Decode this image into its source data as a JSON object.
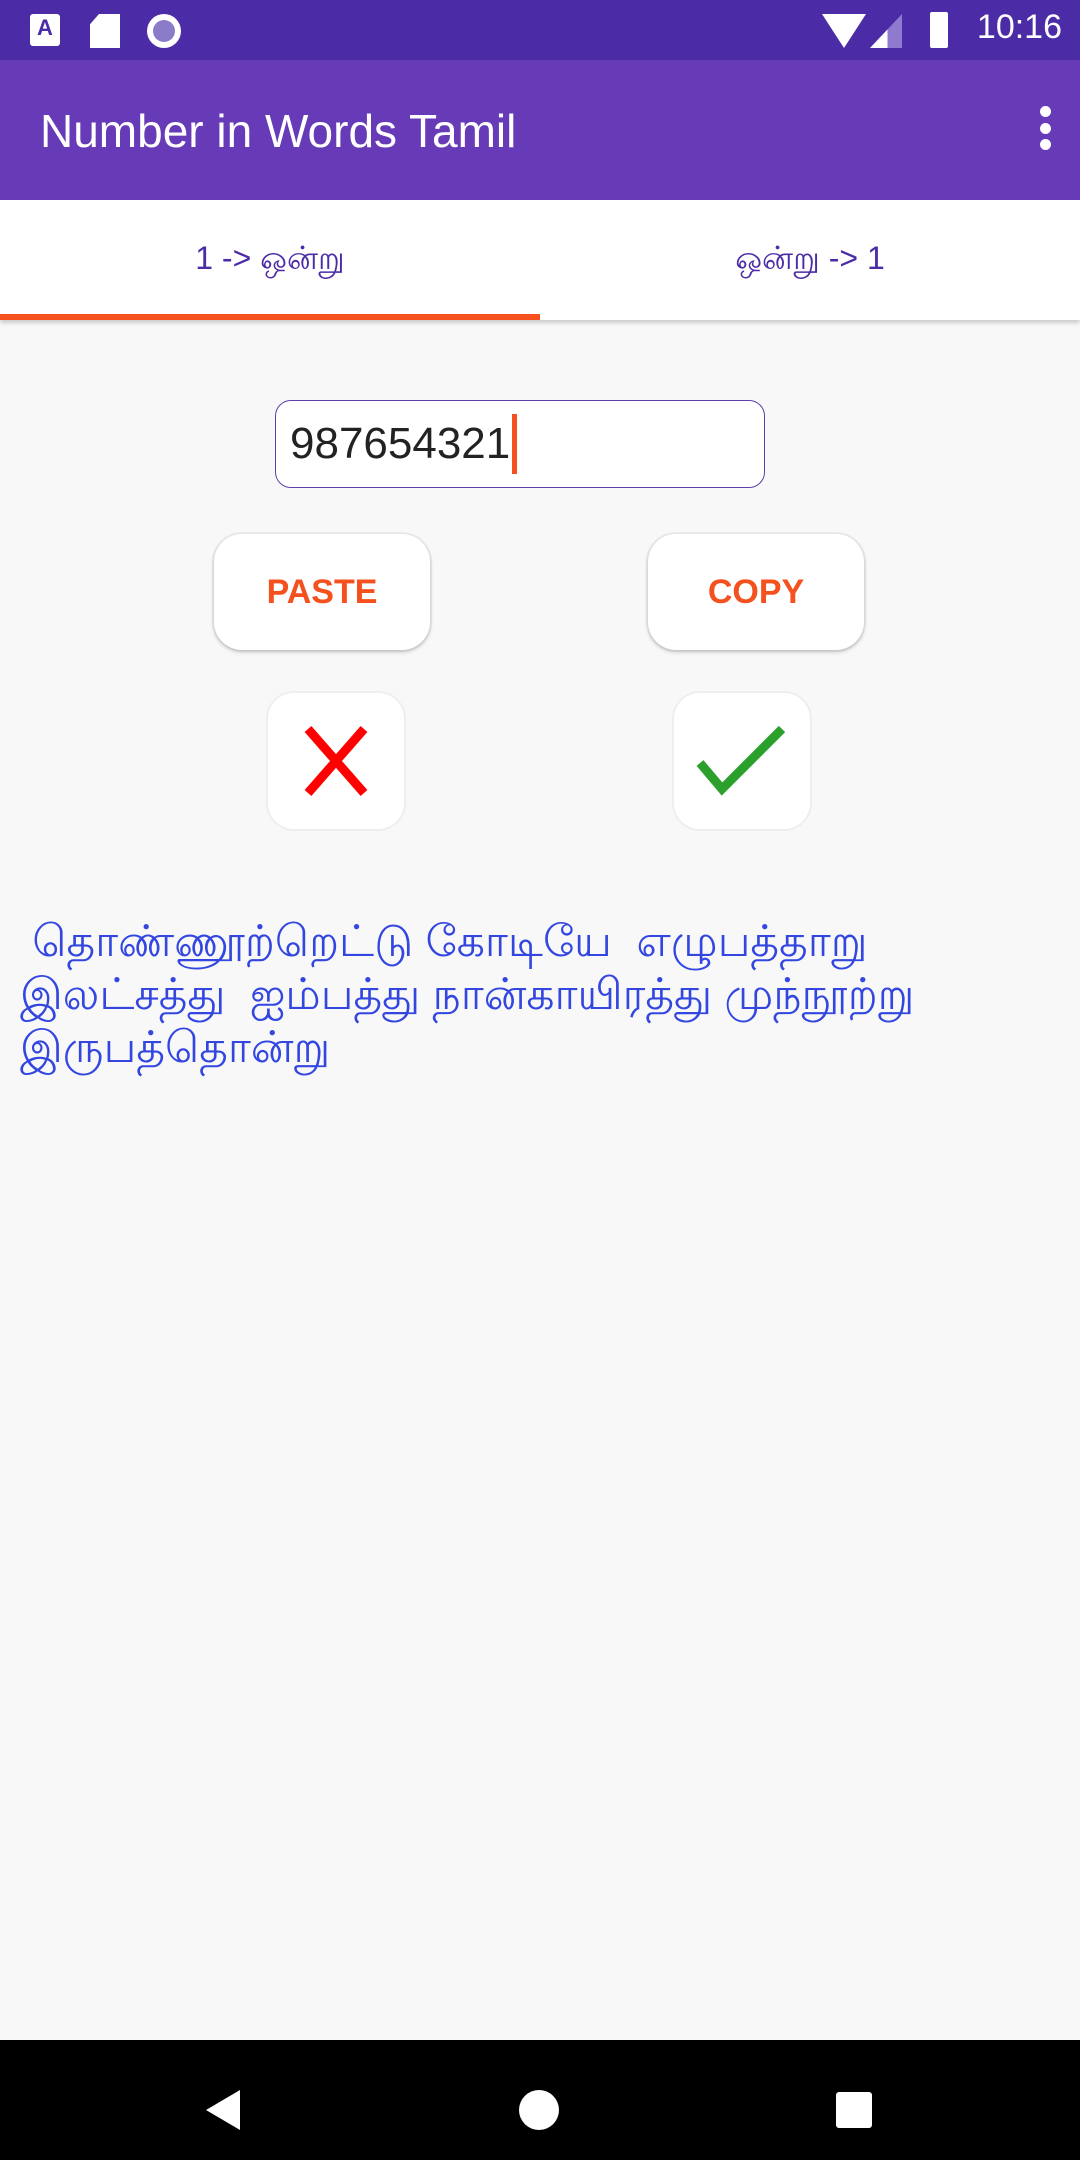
{
  "status_bar": {
    "time": "10:16",
    "icons": [
      "accessibility-a-icon",
      "sd-card-icon",
      "record-icon",
      "wifi-icon",
      "signal-icon",
      "battery-icon"
    ]
  },
  "app_bar": {
    "title": "Number in Words Tamil",
    "overflow_icon": "more-vert-icon"
  },
  "tabs": [
    {
      "label": "1 -> ஒன்று",
      "selected": true
    },
    {
      "label": "ஒன்று -> 1",
      "selected": false
    }
  ],
  "input": {
    "value": "987654321"
  },
  "buttons": {
    "paste_label": "PASTE",
    "copy_label": "COPY",
    "clear_icon": "close-icon",
    "convert_icon": "check-icon"
  },
  "result": {
    "text": " தொண்ணூற்றெட்டு கோடியே  எழுபத்தாறு இலட்சத்து  ஐம்பத்து நான்காயிரத்து முந்நூற்று இருபத்தொன்று"
  },
  "colors": {
    "status_bar": "#4b2ca6",
    "app_bar": "#673ab7",
    "accent": "#f4511e",
    "tab_text": "#4b2ca6",
    "result_text": "#3347e0",
    "clear_red": "#ff0000",
    "check_green": "#2ca02c"
  },
  "nav_bar": {
    "icons": [
      "back-icon",
      "home-icon",
      "recents-icon"
    ]
  }
}
